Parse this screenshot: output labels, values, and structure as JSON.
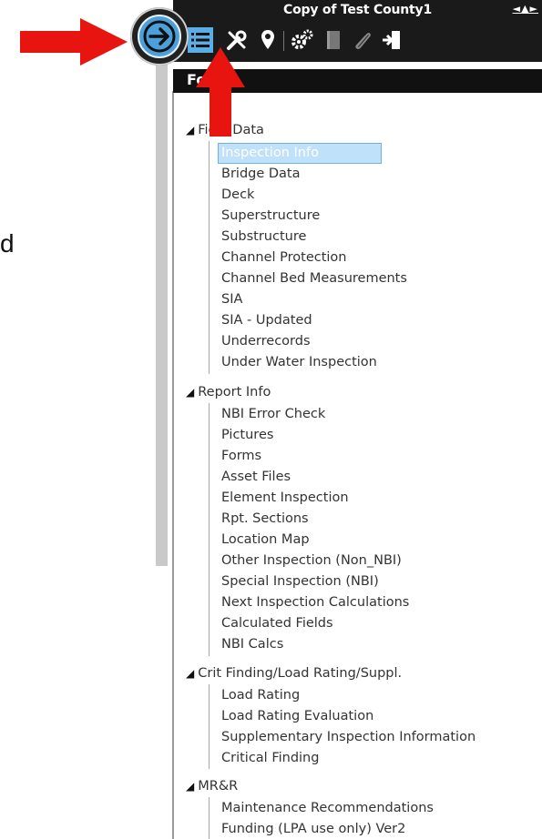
{
  "stray_text": "d",
  "app": {
    "title": "Copy of Test County1",
    "title_controls": [
      "◄",
      "▲",
      "►"
    ]
  },
  "toolbar": {
    "tools": [
      {
        "icon": "list-icon",
        "active": true
      },
      {
        "icon": "tools-icon",
        "active": false
      },
      {
        "icon": "map-pin-icon",
        "active": false
      },
      {
        "icon": "gears-icon",
        "active": false
      },
      {
        "icon": "document-icon",
        "active": false
      },
      {
        "icon": "paperclip-icon",
        "active": false
      },
      {
        "icon": "exit-icon",
        "active": false
      }
    ]
  },
  "navigate_button_icon": "arrow-right-icon",
  "forms_header": "Forms",
  "groups": [
    {
      "label": "Field Data",
      "items": [
        "Inspection Info",
        "Bridge Data",
        "Deck",
        "Superstructure",
        "Substructure",
        "Channel Protection",
        "Channel Bed Measurements",
        "SIA",
        "SIA - Updated",
        "Underrecords",
        "Under Water Inspection"
      ],
      "selected": "Inspection Info"
    },
    {
      "label": "Report Info",
      "items": [
        "NBI Error Check",
        "Pictures",
        "Forms",
        "Asset Files",
        "Element Inspection",
        "Rpt. Sections",
        "Location Map",
        "Other Inspection (Non_NBI)",
        "Special Inspection (NBI)",
        "Next Inspection Calculations",
        "Calculated Fields",
        "NBI Calcs"
      ]
    },
    {
      "label": "Crit Finding/Load Rating/Suppl.",
      "items": [
        "Load Rating",
        "Load Rating Evaluation",
        "Supplementary Inspection Information",
        "Critical Finding"
      ]
    },
    {
      "label": "MR&R",
      "items": [
        "Maintenance Recommendations",
        "Funding (LPA use only) Ver2"
      ]
    }
  ],
  "colors": {
    "accent": "#4b9fdb",
    "selected_bg": "#bfe1fa",
    "annotation_arrow": "#e8140f",
    "toolbar_bg": "#1a1a1a"
  }
}
